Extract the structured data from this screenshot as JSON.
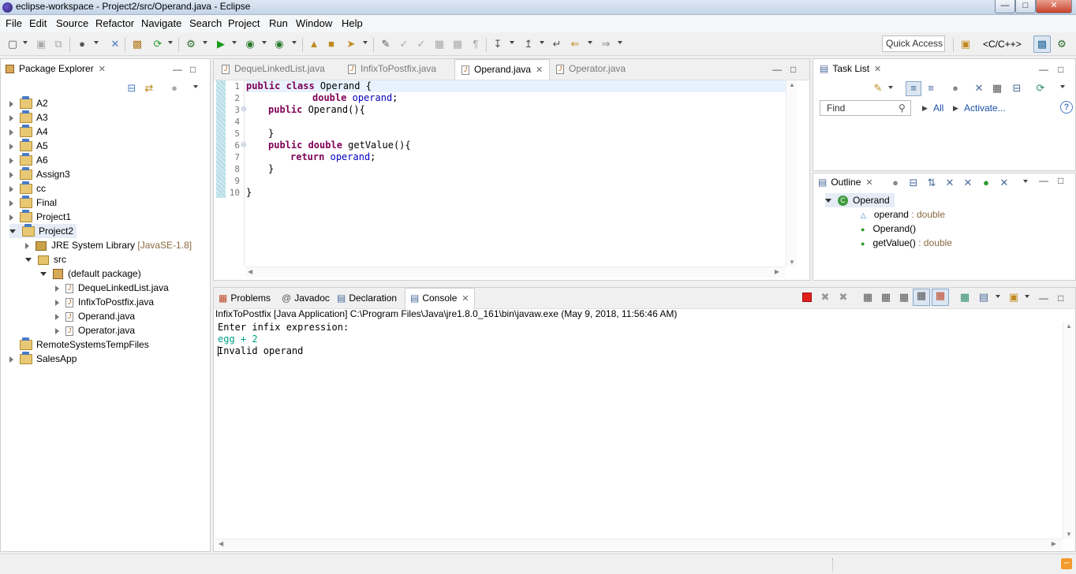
{
  "window": {
    "title": "eclipse-workspace - Project2/src/Operand.java - Eclipse",
    "minimize": "—",
    "maximize": "□",
    "close": "✕"
  },
  "menu": [
    "File",
    "Edit",
    "Source",
    "Refactor",
    "Navigate",
    "Search",
    "Project",
    "Run",
    "Window",
    "Help"
  ],
  "toolbar": {
    "quick_access": "Quick Access",
    "perspective": "<C/C++>"
  },
  "package_explorer": {
    "title": "Package Explorer",
    "projects": [
      {
        "label": "A2",
        "expanded": false
      },
      {
        "label": "A3",
        "expanded": false
      },
      {
        "label": "A4",
        "expanded": false
      },
      {
        "label": "A5",
        "expanded": false
      },
      {
        "label": "A6",
        "expanded": false
      },
      {
        "label": "Assign3",
        "expanded": false
      },
      {
        "label": "cc",
        "expanded": false
      },
      {
        "label": "Final",
        "expanded": false
      },
      {
        "label": "Project1",
        "expanded": false
      },
      {
        "label": "Project2",
        "expanded": true
      }
    ],
    "jre": {
      "label": "JRE System Library",
      "decoration": "[JavaSE-1.8]"
    },
    "src": "src",
    "default_package": "(default package)",
    "files": [
      "DequeLinkedList.java",
      "InfixToPostfix.java",
      "Operand.java",
      "Operator.java"
    ],
    "other_projects": [
      "RemoteSystemsTempFiles",
      "SalesApp"
    ]
  },
  "editor": {
    "tabs": [
      "DequeLinkedList.java",
      "InfixToPostfix.java",
      "Operand.java",
      "Operator.java"
    ],
    "active_tab": "Operand.java",
    "line_numbers": [
      "1",
      "2",
      "3",
      "4",
      "5",
      "6",
      "7",
      "8",
      "9",
      "10"
    ],
    "code": {
      "l1_kw": "public class",
      "l1_rest": " Operand {",
      "l2_kw": "double",
      "l2_field": "operand",
      "l2_end": ";",
      "l3_kw": "public",
      "l3_rest": " Operand(){",
      "l5": "}",
      "l6_kw": "public double",
      "l6_rest": " getValue(){",
      "l7_kw": "return",
      "l7_field": "operand",
      "l7_end": ";",
      "l8": "}",
      "l10": "}"
    }
  },
  "task_list": {
    "title": "Task List",
    "find_placeholder": "Find",
    "all": "All",
    "activate": "Activate..."
  },
  "outline": {
    "title": "Outline",
    "class_name": "Operand",
    "members": [
      {
        "name": "operand",
        "type": " : double"
      },
      {
        "name": "Operand()",
        "type": ""
      },
      {
        "name": "getValue()",
        "type": " : double"
      }
    ]
  },
  "console": {
    "tabs": [
      "Problems",
      "Javadoc",
      "Declaration",
      "Console"
    ],
    "active_tab": "Console",
    "launch_info": "InfixToPostfix [Java Application] C:\\Program Files\\Java\\jre1.8.0_161\\bin\\javaw.exe (May 9, 2018, 11:56:46 AM)",
    "output": [
      {
        "text": "Enter infix expression:",
        "color": "#000000"
      },
      {
        "text": "egg + 2",
        "color": "#00a08a"
      },
      {
        "text": "Invalid operand",
        "color": "#000000"
      }
    ]
  },
  "colors": {
    "keyword": "#7f0055",
    "field": "#0000c0",
    "link": "#1d4fa8",
    "console_input": "#00a08a",
    "terminate": "#e0201a"
  }
}
